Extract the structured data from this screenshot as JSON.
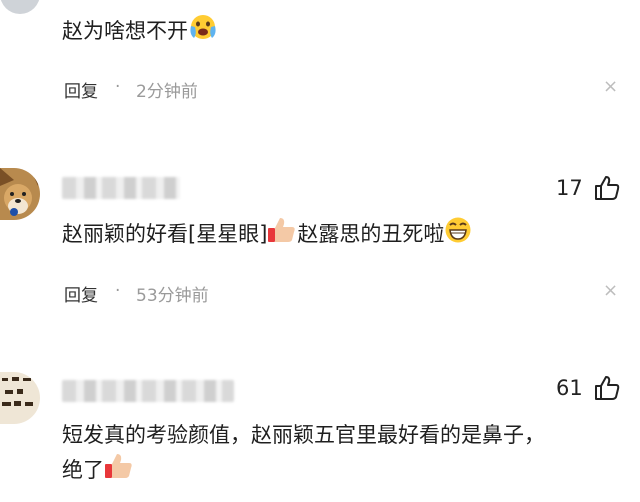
{
  "comments": [
    {
      "text": "赵为啥想不开",
      "emoji_icon": "crying-face-icon",
      "reply_label": "回复",
      "separator": "·",
      "time": "2分钟前",
      "close_glyph": "×"
    },
    {
      "likes": "17",
      "text_part1": "赵丽颖的好看[星星眼]",
      "text_part2": "赵露思的丑死啦",
      "emoji_icons": [
        "thumbs-up-icon",
        "grinning-face-icon"
      ],
      "reply_label": "回复",
      "separator": "·",
      "time": "53分钟前",
      "close_glyph": "×"
    },
    {
      "likes": "61",
      "text_line1": "短发真的考验颜值，赵丽颖五官里最好看的是鼻子，",
      "text_line2": "绝了",
      "emoji_icons": [
        "thumbs-up-icon"
      ]
    }
  ],
  "colors": {
    "background": "#ffffff",
    "text": "#1f1f1f",
    "muted": "#9a9a9a",
    "close": "#bdbdbd"
  }
}
